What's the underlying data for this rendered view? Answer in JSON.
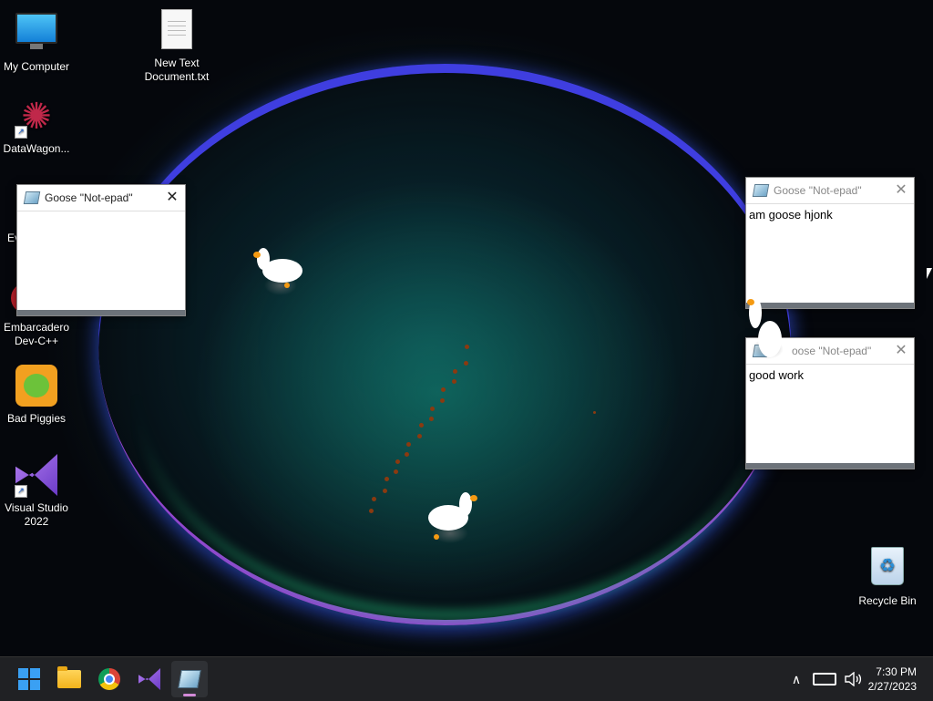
{
  "desktop": {
    "icons": [
      {
        "label": "My Computer",
        "icon": "monitor-icon"
      },
      {
        "label": "New Text Document.txt",
        "icon": "text-document-icon"
      },
      {
        "label": "DataWagon...",
        "icon": "datawagon-icon"
      },
      {
        "label": "Ev",
        "icon": "partial-icon"
      },
      {
        "label": "Embarcadero Dev-C++",
        "icon": "devcpp-icon"
      },
      {
        "label": "Bad Piggies",
        "icon": "bad-piggies-icon"
      },
      {
        "label": "Visual Studio 2022",
        "icon": "visual-studio-icon"
      },
      {
        "label": "Recycle Bin",
        "icon": "recycle-bin-icon"
      }
    ]
  },
  "notepads": [
    {
      "title": "Goose \"Not-epad\"",
      "content": "",
      "close": "✕"
    },
    {
      "title": "Goose \"Not-epad\"",
      "content": "am goose hjonk",
      "close": "✕"
    },
    {
      "title": "oose \"Not-epad\"",
      "content": "good work",
      "close": "✕"
    }
  ],
  "taskbar": {
    "apps": [
      {
        "name": "start",
        "icon": "windows-start-icon"
      },
      {
        "name": "file-explorer",
        "icon": "folder-icon"
      },
      {
        "name": "chrome",
        "icon": "chrome-icon"
      },
      {
        "name": "visual-studio",
        "icon": "visual-studio-icon"
      },
      {
        "name": "goose-notepad",
        "icon": "notepad-icon",
        "active": true
      }
    ],
    "tray": {
      "chevron": "∧",
      "time": "7:30 PM",
      "date": "2/27/2023"
    }
  },
  "colors": {
    "taskbar": "#202124",
    "accent": "#d38ad8",
    "goose_beak": "#f59a12"
  }
}
